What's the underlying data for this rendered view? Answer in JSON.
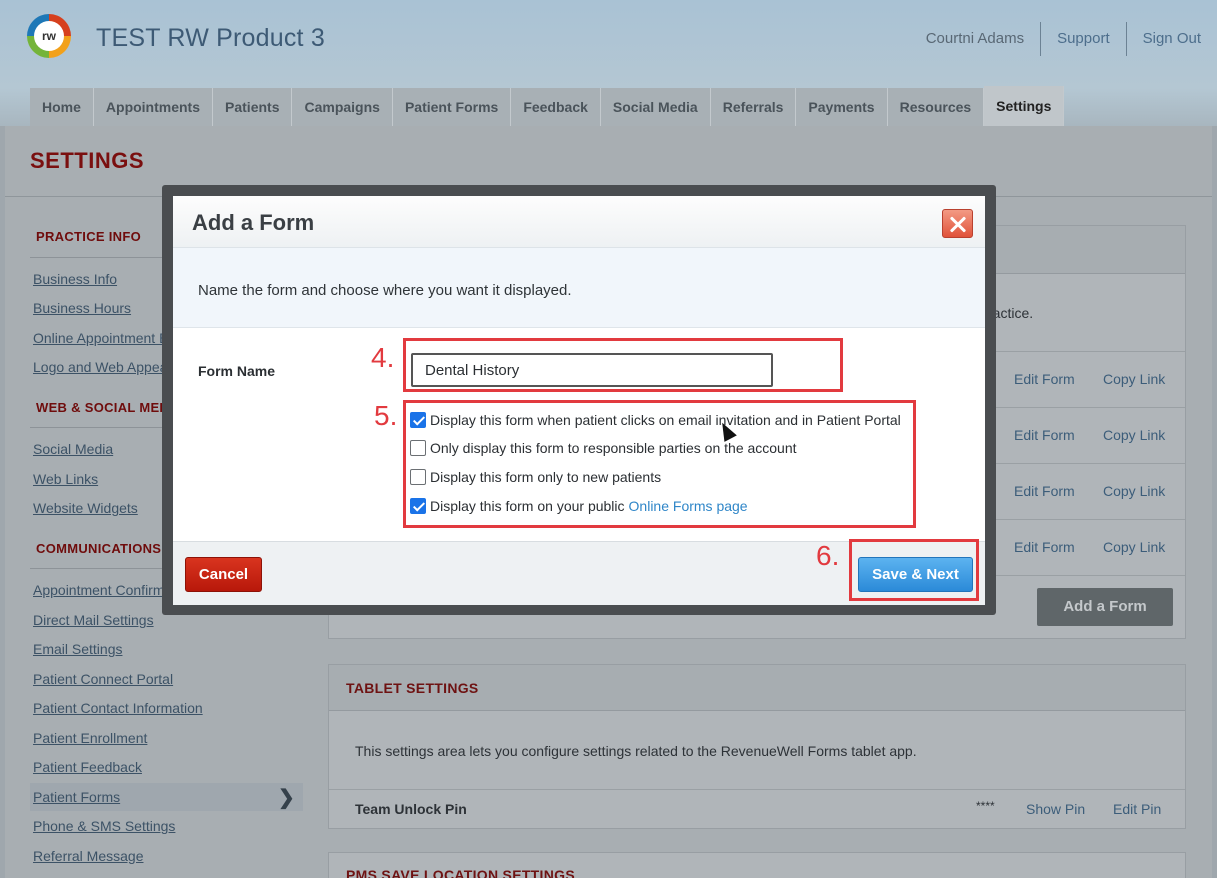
{
  "app": {
    "logo_text": "rw",
    "title": "TEST RW Product 3",
    "user_name": "Courtni Adams",
    "support_label": "Support",
    "sign_out_label": "Sign Out"
  },
  "tabs": [
    "Home",
    "Appointments",
    "Patients",
    "Campaigns",
    "Patient Forms",
    "Feedback",
    "Social Media",
    "Referrals",
    "Payments",
    "Resources",
    "Settings"
  ],
  "active_tab": "Settings",
  "page_title": "SETTINGS",
  "sidebar": {
    "sections": [
      {
        "heading": "PRACTICE INFO",
        "items": [
          "Business Info",
          "Business Hours",
          "Online Appointment Bo",
          "Logo and Web Appears"
        ]
      },
      {
        "heading": "WEB & SOCIAL MEI",
        "items": [
          "Social Media",
          "Web Links",
          "Website Widgets"
        ]
      },
      {
        "heading": "COMMUNICATIONS",
        "items": [
          "Appointment Confirmat",
          "Direct Mail Settings",
          "Email Settings",
          "Patient Connect Portal",
          "Patient Contact Information",
          "Patient Enrollment",
          "Patient Feedback",
          "Patient Forms",
          "Phone & SMS Settings",
          "Referral Message"
        ]
      }
    ],
    "active_item": "Patient Forms"
  },
  "forms_panel": {
    "partial_text": "ractice.",
    "rows": [
      {
        "edit_label": "Edit Form",
        "copy_label": "Copy Link"
      },
      {
        "edit_label": "Edit Form",
        "copy_label": "Copy Link"
      },
      {
        "edit_label": "Edit Form",
        "copy_label": "Copy Link"
      },
      {
        "edit_label": "Edit Form",
        "copy_label": "Copy Link"
      }
    ],
    "add_button": "Add a Form"
  },
  "tablet_panel": {
    "title": "TABLET SETTINGS",
    "description": "This settings area lets you configure settings related to the RevenueWell Forms tablet app.",
    "pin_label": "Team Unlock Pin",
    "pin_value": "****",
    "show_pin": "Show Pin",
    "edit_pin": "Edit Pin"
  },
  "pms_panel": {
    "title": "PMS SAVE LOCATION SETTINGS"
  },
  "modal": {
    "title": "Add a Form",
    "intro": "Name the form and choose where you want it displayed.",
    "form_name_label": "Form Name",
    "form_name_value": "Dental History",
    "options": [
      {
        "label": "Display this form when patient clicks on email invitation and in Patient Portal",
        "checked": true
      },
      {
        "label": "Only display this form to responsible parties on the account",
        "checked": false
      },
      {
        "label": "Display this form only to new patients",
        "checked": false
      },
      {
        "label": "Display this form on your public",
        "link": "Online Forms page",
        "checked": true
      }
    ],
    "cancel_label": "Cancel",
    "save_label": "Save & Next"
  },
  "annotations": [
    "4.",
    "5.",
    "6."
  ],
  "colors": {
    "annotation_red": "#e23a3f",
    "cancel_red": "#c8220f",
    "save_blue": "#3a97e0",
    "heading_maroon": "#7a0f0f"
  }
}
